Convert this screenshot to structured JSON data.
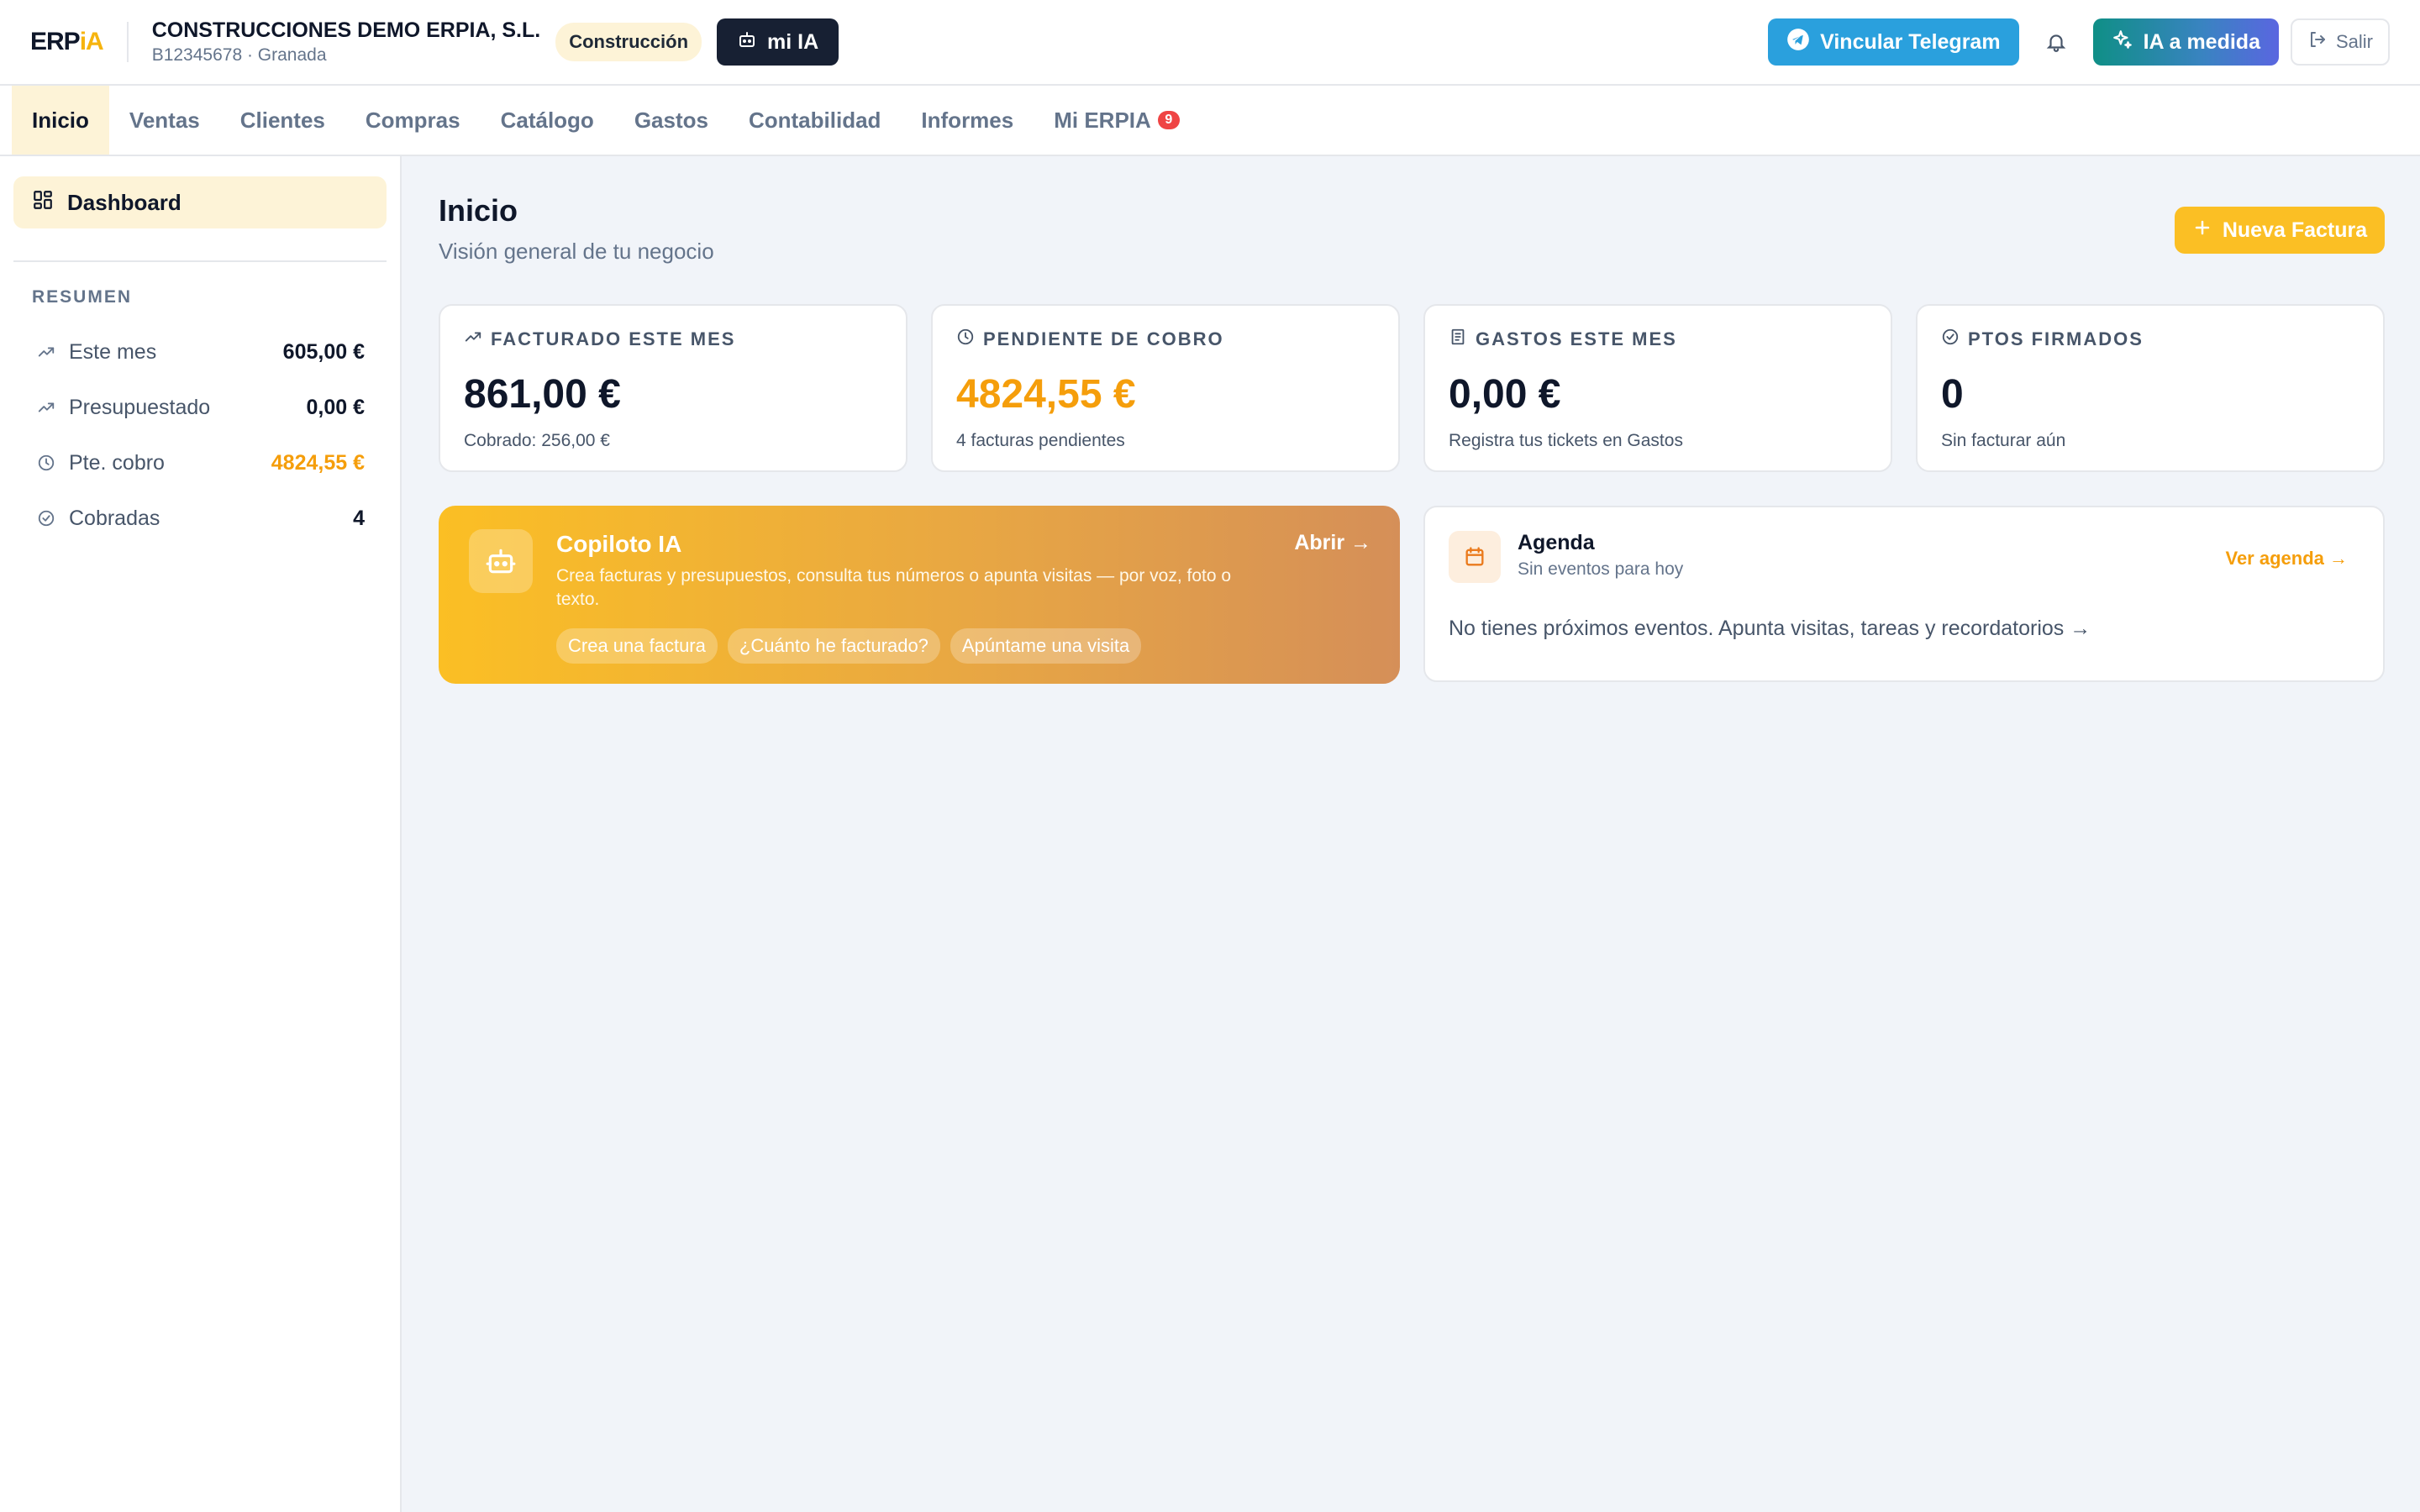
{
  "header": {
    "logo_erp": "ERP",
    "logo_ia": "iA",
    "company_name": "CONSTRUCCIONES DEMO ERPIA, S.L.",
    "company_sub": "B12345678 · Granada",
    "sector": "Construcción",
    "mi_ia_label": "mi IA",
    "telegram_label": "Vincular Telegram",
    "ia_medida_label": "IA a medida",
    "salir_label": "Salir"
  },
  "nav": {
    "items": [
      {
        "label": "Inicio"
      },
      {
        "label": "Ventas"
      },
      {
        "label": "Clientes"
      },
      {
        "label": "Compras"
      },
      {
        "label": "Catálogo"
      },
      {
        "label": "Gastos"
      },
      {
        "label": "Contabilidad"
      },
      {
        "label": "Informes"
      },
      {
        "label": "Mi ERPIA",
        "badge": "9"
      }
    ],
    "active_index": 0
  },
  "sidebar": {
    "dashboard_label": "Dashboard",
    "section_title": "RESUMEN",
    "rows": [
      {
        "label": "Este mes",
        "value": "605,00 €",
        "icon": "trending-up-icon"
      },
      {
        "label": "Presupuestado",
        "value": "0,00 €",
        "icon": "trending-up-icon"
      },
      {
        "label": "Pte. cobro",
        "value": "4824,55 €",
        "icon": "clock-icon"
      },
      {
        "label": "Cobradas",
        "value": "4",
        "icon": "check-circle-icon"
      }
    ]
  },
  "main": {
    "title": "Inicio",
    "subtitle": "Visión general de tu negocio",
    "new_invoice_label": "Nueva Factura",
    "stats": [
      {
        "label": "FACTURADO ESTE MES",
        "value": "861,00 €",
        "note": "Cobrado: 256,00 €",
        "icon": "trending-up-icon"
      },
      {
        "label": "PENDIENTE DE COBRO",
        "value": "4824,55 €",
        "note": "4 facturas pendientes",
        "icon": "clock-icon"
      },
      {
        "label": "GASTOS ESTE MES",
        "value": "0,00 €",
        "note": "Registra tus tickets en Gastos",
        "icon": "receipt-icon"
      },
      {
        "label": "PTOS FIRMADOS",
        "value": "0",
        "note": "Sin facturar aún",
        "icon": "check-circle-icon"
      }
    ],
    "copilot": {
      "title": "Copiloto IA",
      "description": "Crea facturas y presupuestos, consulta tus números o apunta visitas — por voz, foto o texto.",
      "open_label": "Abrir →",
      "chips": [
        "Crea una factura",
        "¿Cuánto he facturado?",
        "Apúntame una visita"
      ]
    },
    "agenda": {
      "title": "Agenda",
      "subtitle": "Sin eventos para hoy",
      "link_label": "Ver agenda →",
      "empty_text": "No tienes próximos eventos. Apunta visitas, tareas y recordatorios →"
    }
  },
  "colors": {
    "accent": "#fbbf24",
    "warning_value": "#f59e0b",
    "telegram": "#2aa0dd",
    "dark_button": "#172033",
    "active_nav_bg": "#fdf3d7"
  }
}
